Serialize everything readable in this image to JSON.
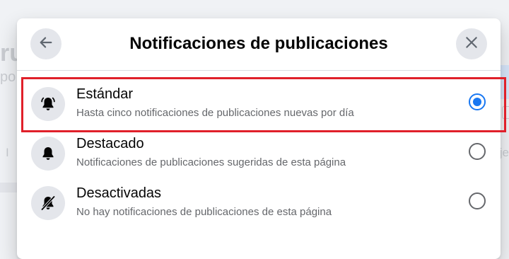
{
  "background": {
    "fragment_title": "ru",
    "fragment_sub": "po",
    "fragment_left": "I",
    "fragment_right": "je"
  },
  "dialog": {
    "title": "Notificaciones de publicaciones",
    "back_icon": "arrow-left-icon",
    "close_icon": "close-icon",
    "options": [
      {
        "title": "Estándar",
        "description": "Hasta cinco notificaciones de publicaciones nuevas por día",
        "icon": "bell-ringing-icon",
        "selected": true
      },
      {
        "title": "Destacado",
        "description": "Notificaciones de publicaciones sugeridas de esta página",
        "icon": "bell-icon",
        "selected": false
      },
      {
        "title": "Desactivadas",
        "description": "No hay notificaciones de publicaciones de esta página",
        "icon": "bell-off-icon",
        "selected": false
      }
    ]
  },
  "colors": {
    "accent": "#1877f2",
    "highlight": "#e0202a"
  }
}
